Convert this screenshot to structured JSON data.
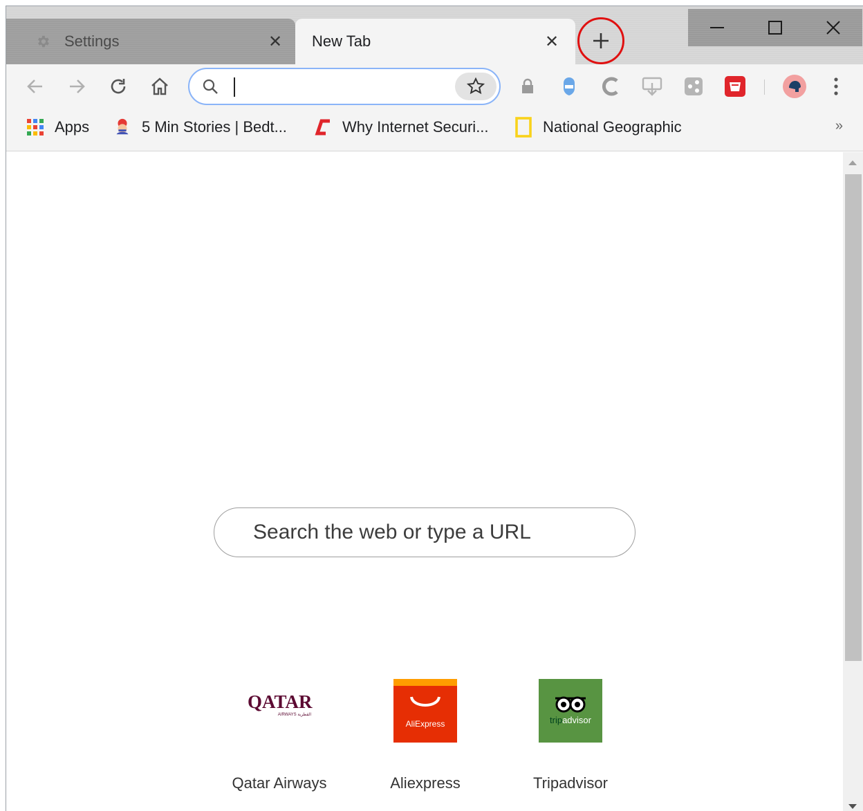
{
  "tabs": [
    {
      "title": "Settings",
      "icon": "gear-icon",
      "active": false
    },
    {
      "title": "New Tab",
      "active": true
    }
  ],
  "window_controls": {
    "minimize": "minimize-icon",
    "maximize": "maximize-icon",
    "close": "close-icon"
  },
  "omnibox": {
    "value": "",
    "placeholder": ""
  },
  "toolbar_icons": [
    "back-arrow-icon",
    "forward-arrow-icon",
    "reload-icon",
    "home-icon",
    "bookmark-star-icon",
    "lock-extension-icon",
    "shield-extension-icon",
    "comodo-extension-icon",
    "download-extension-icon",
    "share-extension-icon",
    "red-extension-icon",
    "profile-avatar-icon",
    "menu-dots-icon"
  ],
  "bookmarks": [
    {
      "label": "Apps",
      "icon": "apps-grid-icon"
    },
    {
      "label": "5 Min Stories | Bedt...",
      "icon": "stories-icon"
    },
    {
      "label": "Why Internet Securi...",
      "icon": "comodo-c-icon"
    },
    {
      "label": "National Geographic",
      "icon": "natgeo-frame-icon"
    }
  ],
  "bookmarks_overflow": "»",
  "new_tab_page": {
    "search_placeholder": "Search the web or type a URL",
    "tiles": [
      {
        "label": "Qatar Airways",
        "logo_text": "QATAR",
        "logo_sub": "AIRWAYS القطرية"
      },
      {
        "label": "Aliexpress",
        "logo_text": "AliExpress"
      },
      {
        "label": "Tripadvisor",
        "logo_text_a": "trip",
        "logo_text_b": "advisor"
      }
    ]
  },
  "colors": {
    "highlight_ring": "#e01010",
    "omnibox_focus": "#8ab4f8",
    "aliexpress": "#e62e04",
    "tripadvisor": "#589442",
    "qatar": "#5c0a32"
  }
}
